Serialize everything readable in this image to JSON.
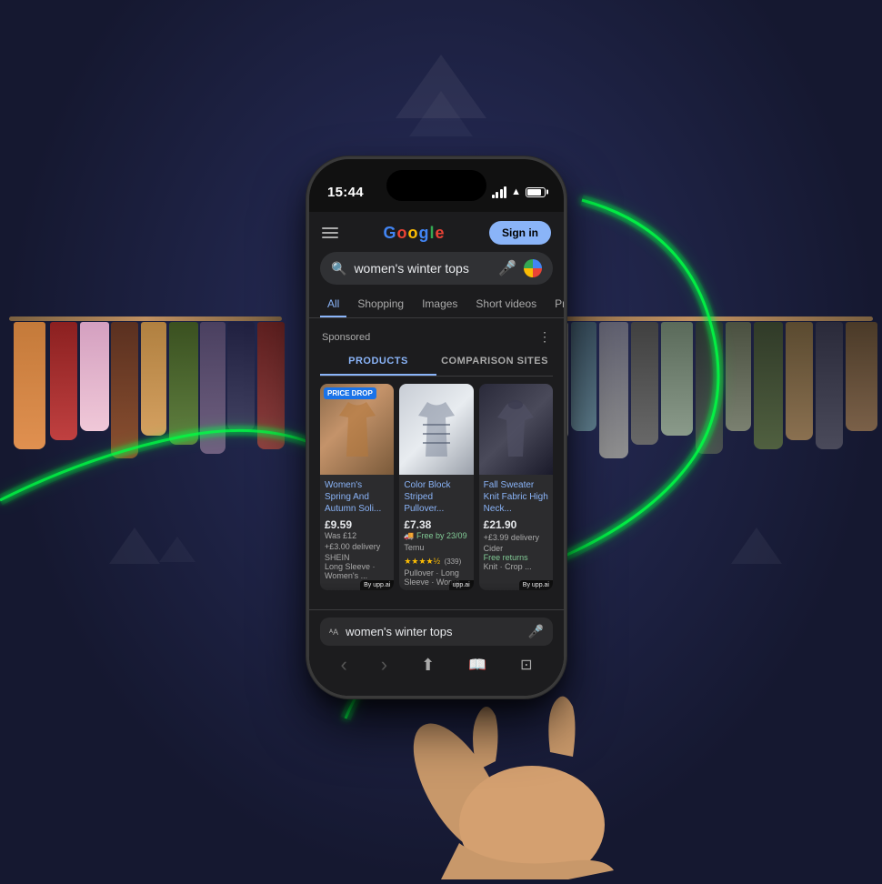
{
  "background": {
    "color": "#1e2240"
  },
  "phone": {
    "time": "15:44",
    "google": {
      "search_query": "women's winter tops",
      "sign_in_label": "Sign in",
      "tabs": [
        {
          "label": "All",
          "active": true
        },
        {
          "label": "Shopping",
          "active": false
        },
        {
          "label": "Images",
          "active": false
        },
        {
          "label": "Short videos",
          "active": false
        },
        {
          "label": "Products",
          "active": false
        }
      ],
      "sponsored_label": "Sponsored",
      "product_tabs": [
        {
          "label": "PRODUCTS",
          "active": true
        },
        {
          "label": "COMPARISON SITES",
          "active": false
        }
      ],
      "products": [
        {
          "id": 1,
          "badge": "PRICE DROP",
          "title": "Women's Spring And Autumn Soli...",
          "price": "£9.59",
          "was": "Was £12",
          "delivery": "+£3.00 delivery",
          "store": "SHEIN",
          "details": "Long Sleeve · Women's ..."
        },
        {
          "id": 2,
          "badge": null,
          "title": "Color Block Striped Pullover...",
          "price": "£7.38",
          "delivery": "Free by 23/09",
          "store": "Temu",
          "rating_count": "(339)",
          "rating": 4.5,
          "details": "Pullover · Long Sleeve · Wome..."
        },
        {
          "id": 3,
          "badge": null,
          "title": "Fall Sweater Knit Fabric High Neck...",
          "price": "£21.90",
          "delivery": "+£3.99 delivery",
          "store": "Cider",
          "returns": "Free returns",
          "details": "Knit · Crop ..."
        }
      ],
      "upp_label": "By upp.ai"
    },
    "safari": {
      "search_text": "women's winter tops"
    }
  },
  "icons": {
    "search": "🔍",
    "voice": "🎤",
    "hamburger": "☰",
    "mic": "🎤",
    "share": "⬆",
    "bookmarks": "📖",
    "tabs": "⊡",
    "chevron_left": "‹",
    "chevron_right": "›"
  }
}
